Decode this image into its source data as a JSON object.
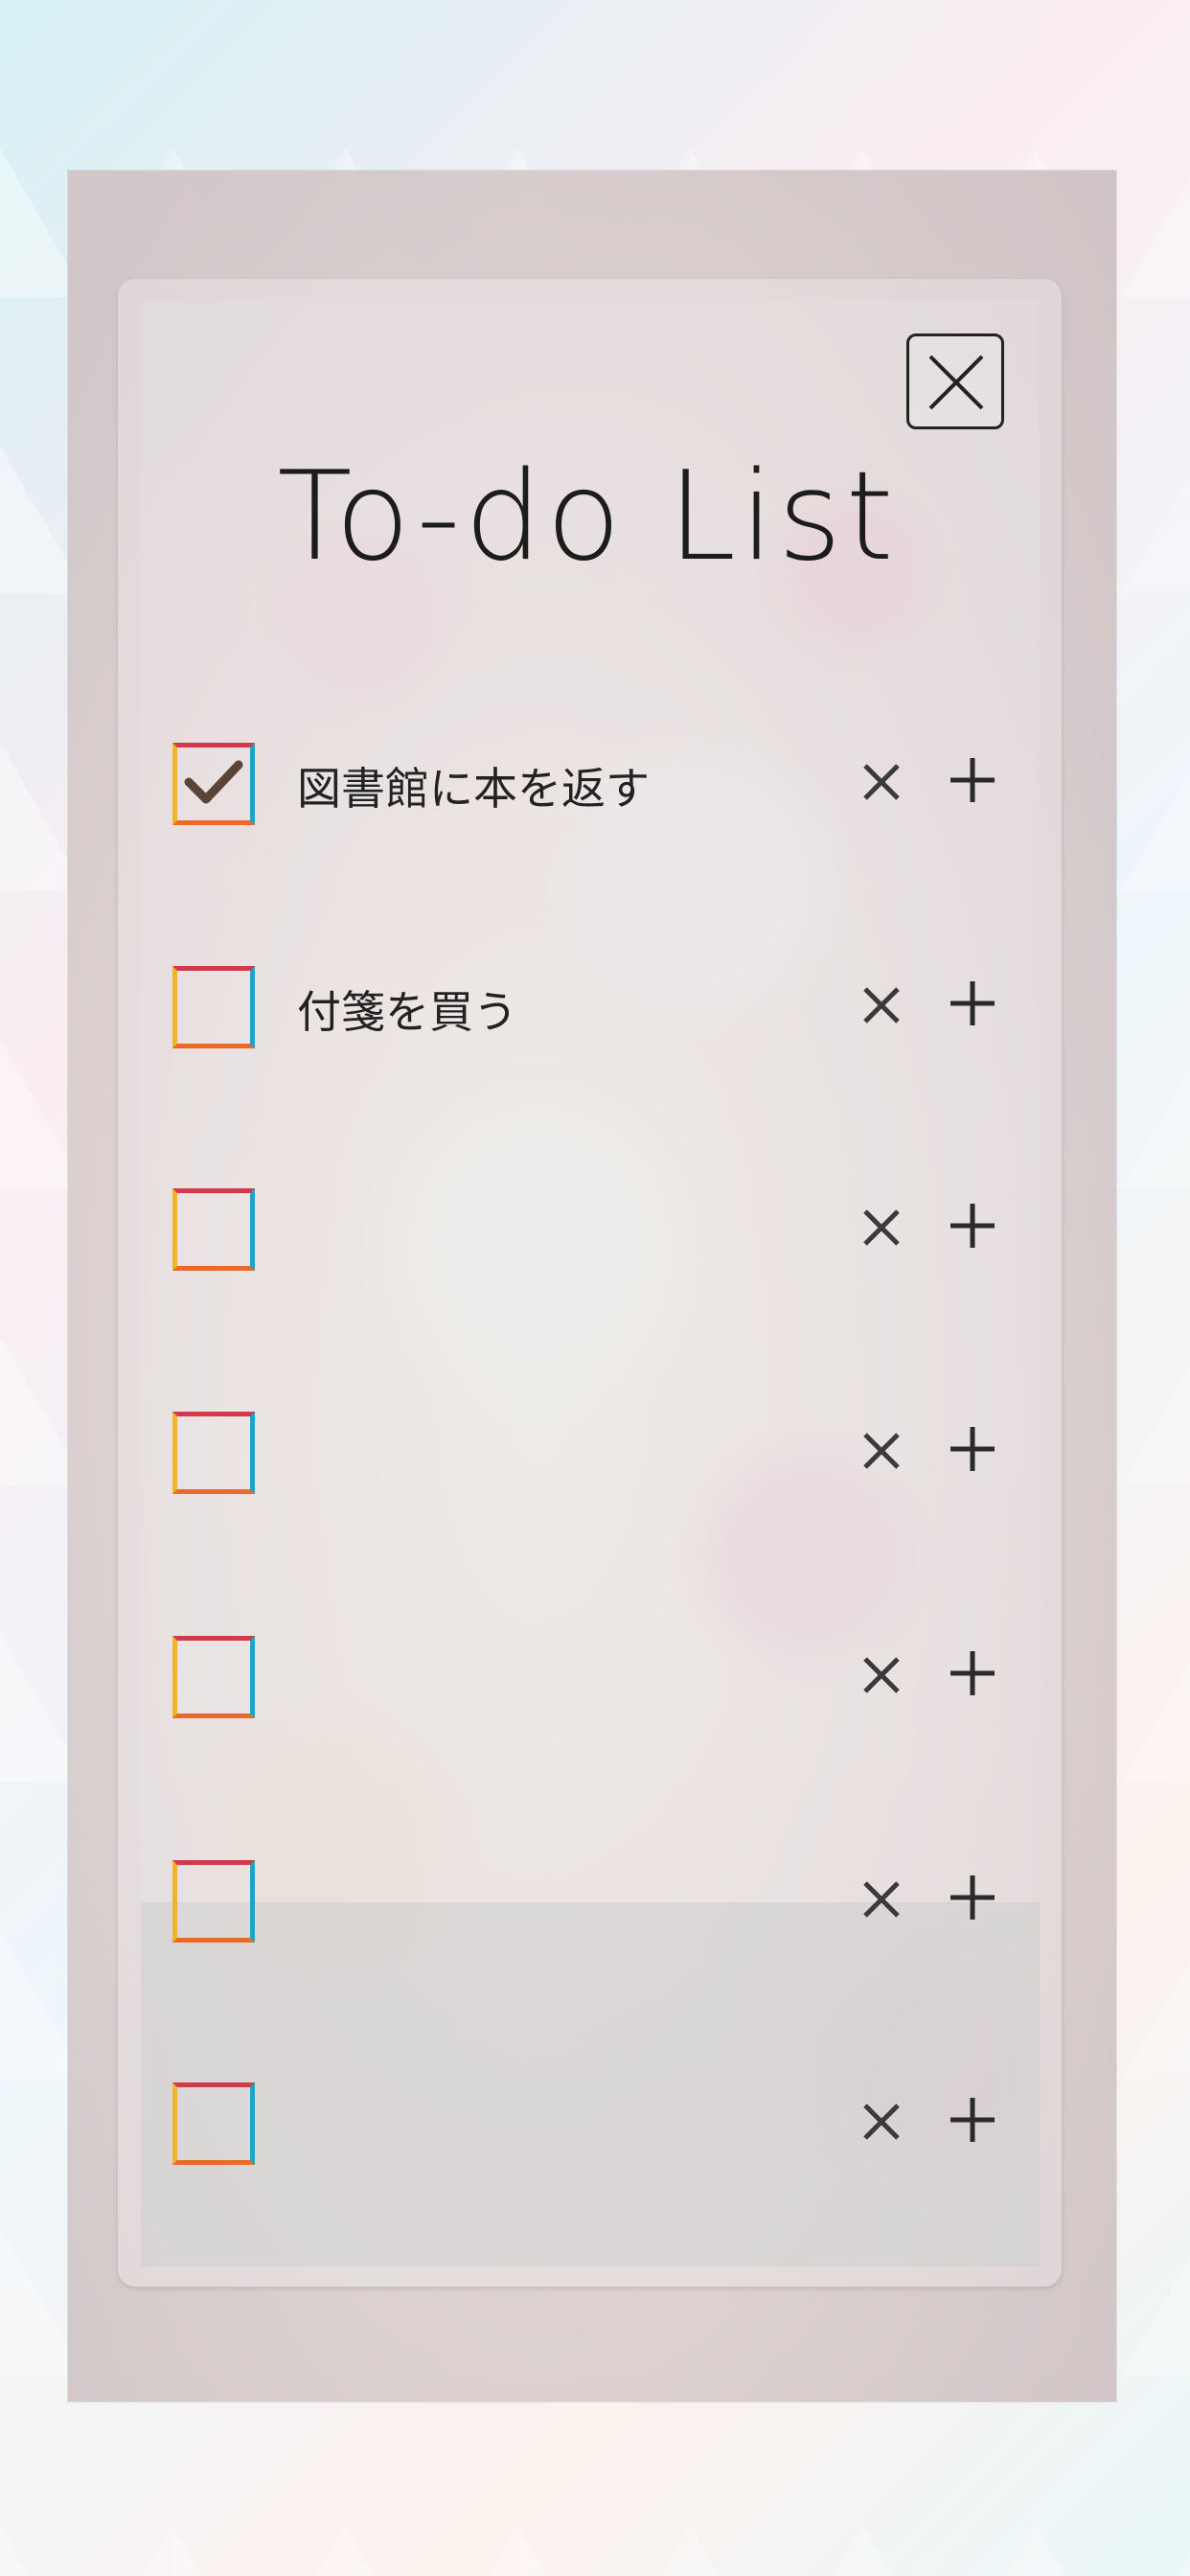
{
  "title": "To-do List",
  "close_button": {
    "icon": "close-icon"
  },
  "items": [
    {
      "text": "図書館に本を返す",
      "checked": true
    },
    {
      "text": "付箋を買う",
      "checked": false
    },
    {
      "text": "",
      "checked": false
    },
    {
      "text": "",
      "checked": false
    },
    {
      "text": "",
      "checked": false
    },
    {
      "text": "",
      "checked": false
    },
    {
      "text": "",
      "checked": false
    }
  ],
  "row_actions": {
    "delete_icon": "times-icon",
    "add_icon": "plus-icon"
  },
  "colors": {
    "checkbox_top": "#d03a4b",
    "checkbox_right": "#1aa6c4",
    "checkbox_bottom": "#ea6a2e",
    "checkbox_left": "#f0b52a",
    "checkmark": "#5a4438",
    "text": "#222222"
  }
}
